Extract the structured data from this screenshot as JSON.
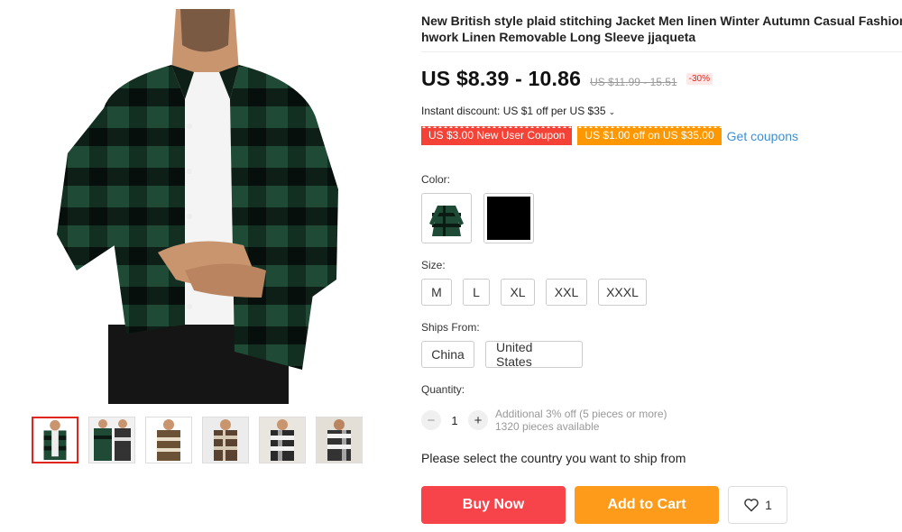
{
  "product": {
    "title_line1": "New British style plaid stitching Jacket Men linen Winter Autumn Casual Fashion Patc",
    "title_line2": "hwork Linen Removable Long Sleeve jjaqueta",
    "price": "US $8.39 - 10.86",
    "original_price": "US $11.99 - 15.51",
    "discount_badge": "-30%"
  },
  "promotions": {
    "instant_discount": "Instant discount: US $1 off per US $35",
    "coupon_new_user": "US $3.00 New User Coupon",
    "coupon_spend": "US $1.00 off on US $35.00",
    "get_coupons": "Get coupons"
  },
  "color": {
    "label": "Color:",
    "options": [
      {
        "icon": "green-plaid-shirt-thumbnail"
      },
      {
        "icon": "black-swatch"
      }
    ]
  },
  "size": {
    "label": "Size:",
    "options": [
      "M",
      "L",
      "XL",
      "XXL",
      "XXXL"
    ]
  },
  "ships_from": {
    "label": "Ships From:",
    "options": [
      "China",
      "United States"
    ]
  },
  "quantity": {
    "label": "Quantity:",
    "minus": "−",
    "value": "1",
    "plus": "+",
    "note1": "Additional 3% off (5 pieces or more)",
    "note2": "1320 pieces available"
  },
  "shipping_message": "Please select the country you want to ship from",
  "actions": {
    "buy_now": "Buy Now",
    "add_to_cart": "Add to Cart",
    "wishlist_count": "1"
  },
  "gallery": {
    "thumbnails": [
      {
        "icon": "thumb-green-plaid",
        "active": true
      },
      {
        "icon": "thumb-green-plaid-pair"
      },
      {
        "icon": "thumb-brown-plaid"
      },
      {
        "icon": "thumb-brown-plaid-2"
      },
      {
        "icon": "thumb-black-white-plaid"
      },
      {
        "icon": "thumb-black-white-plaid-2"
      }
    ]
  },
  "colors": {
    "price_red": "#e1251b",
    "coupon_red": "#f44336",
    "coupon_orange": "#ff9800",
    "link_blue": "#3a8fd6",
    "buy_now": "#f7434a",
    "add_to_cart": "#ff9b1a"
  }
}
